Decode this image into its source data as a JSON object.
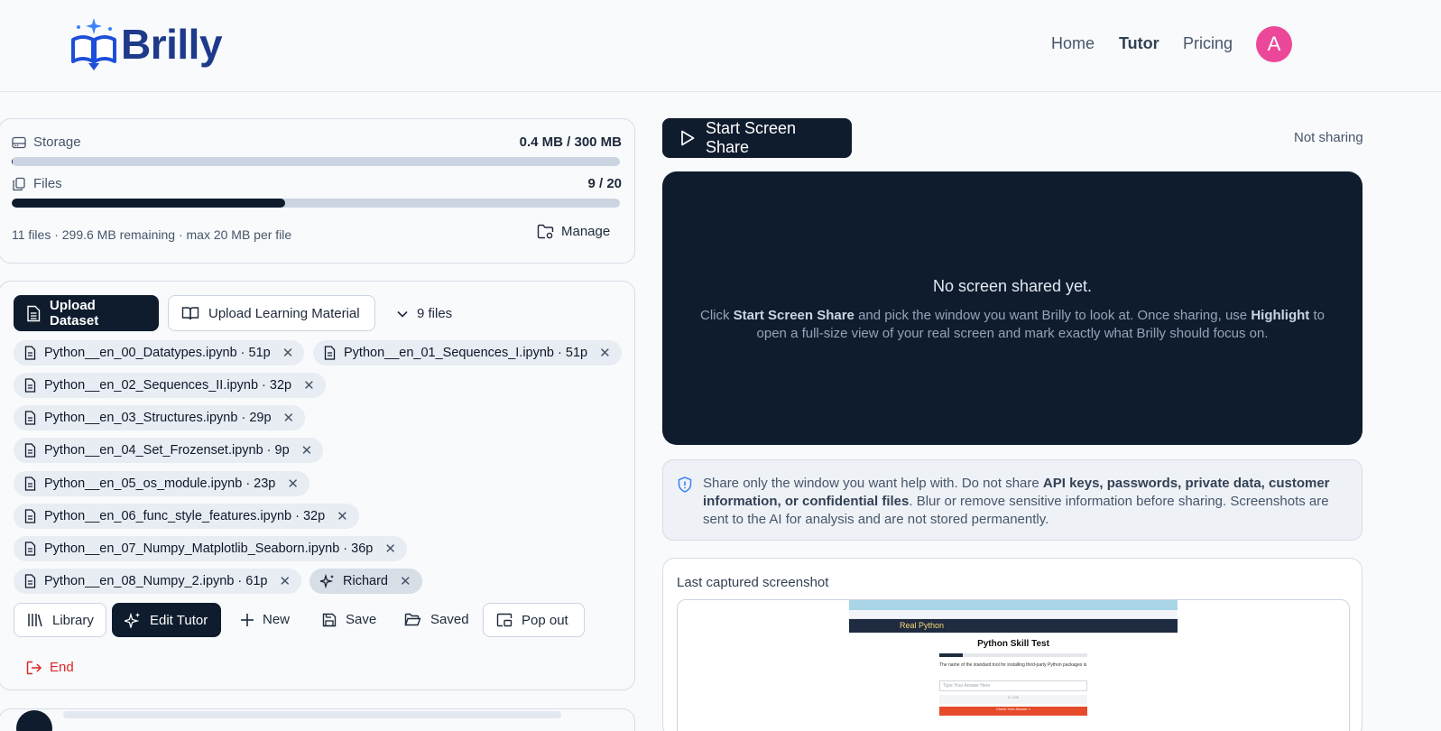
{
  "header": {
    "logo_text": "Brilly",
    "nav": [
      {
        "label": "Home",
        "active": false
      },
      {
        "label": "Tutor",
        "active": true
      },
      {
        "label": "Pricing",
        "active": false
      }
    ],
    "avatar_initial": "A",
    "avatar_color": "#ec4899"
  },
  "storage": {
    "storage_label": "Storage",
    "storage_value": "0.4 MB / 300 MB",
    "storage_fraction": 0.0013,
    "files_label": "Files",
    "files_value": "9 / 20",
    "files_fraction": 0.45,
    "summary": "11 files · 299.6 MB remaining · max 20 MB per file",
    "manage_label": "Manage"
  },
  "files_panel": {
    "upload_dataset_label": "Upload Dataset",
    "upload_material_label": "Upload Learning Material",
    "files_count_label": "9 files",
    "files": [
      "Python__en_00_Datatypes.ipynb · 51p",
      "Python__en_01_Sequences_I.ipynb · 51p",
      "Python__en_02_Sequences_II.ipynb · 32p",
      "Python__en_03_Structures.ipynb · 29p",
      "Python__en_04_Set_Frozenset.ipynb · 9p",
      "Python__en_05_os_module.ipynb · 23p",
      "Python__en_06_func_style_features.ipynb · 32p",
      "Python__en_07_Numpy_Matplotlib_Seaborn.ipynb · 36p",
      "Python__en_08_Numpy_2.ipynb · 61p"
    ],
    "tutor_chip": "Richard",
    "actions": {
      "library": "Library",
      "edit_tutor": "Edit Tutor",
      "new": "New",
      "save": "Save",
      "saved": "Saved",
      "pop_out": "Pop out",
      "end": "End"
    }
  },
  "screen_share": {
    "start_label": "Start Screen Share",
    "status": "Not sharing",
    "empty_title": "No screen shared yet.",
    "empty_p1": "Click ",
    "empty_b1": "Start Screen Share",
    "empty_p2": " and pick the window you want Brilly to look at. Once sharing, use ",
    "empty_b2": "Highlight",
    "empty_p3": " to open a full-size view of your real screen and mark exactly what Brilly should focus on."
  },
  "warning": {
    "p1": "Share only the window you want help with. Do not share ",
    "b1": "API keys, passwords, private data, customer information, or confidential files",
    "p2": ". Blur or remove sensitive information before sharing. Screenshots are sent to the AI for analysis and are not stored permanently."
  },
  "last_capture": {
    "title": "Last captured screenshot",
    "thumb_title": "Python Skill Test",
    "thumb_banner": "Real Python",
    "thumb_question": "The name of the standard tool for installing third-party Python packages is",
    "thumb_input_placeholder": "Type Your Answer Here",
    "thumb_skip": "0 / 100",
    "thumb_check": "Check Your Answer »"
  }
}
